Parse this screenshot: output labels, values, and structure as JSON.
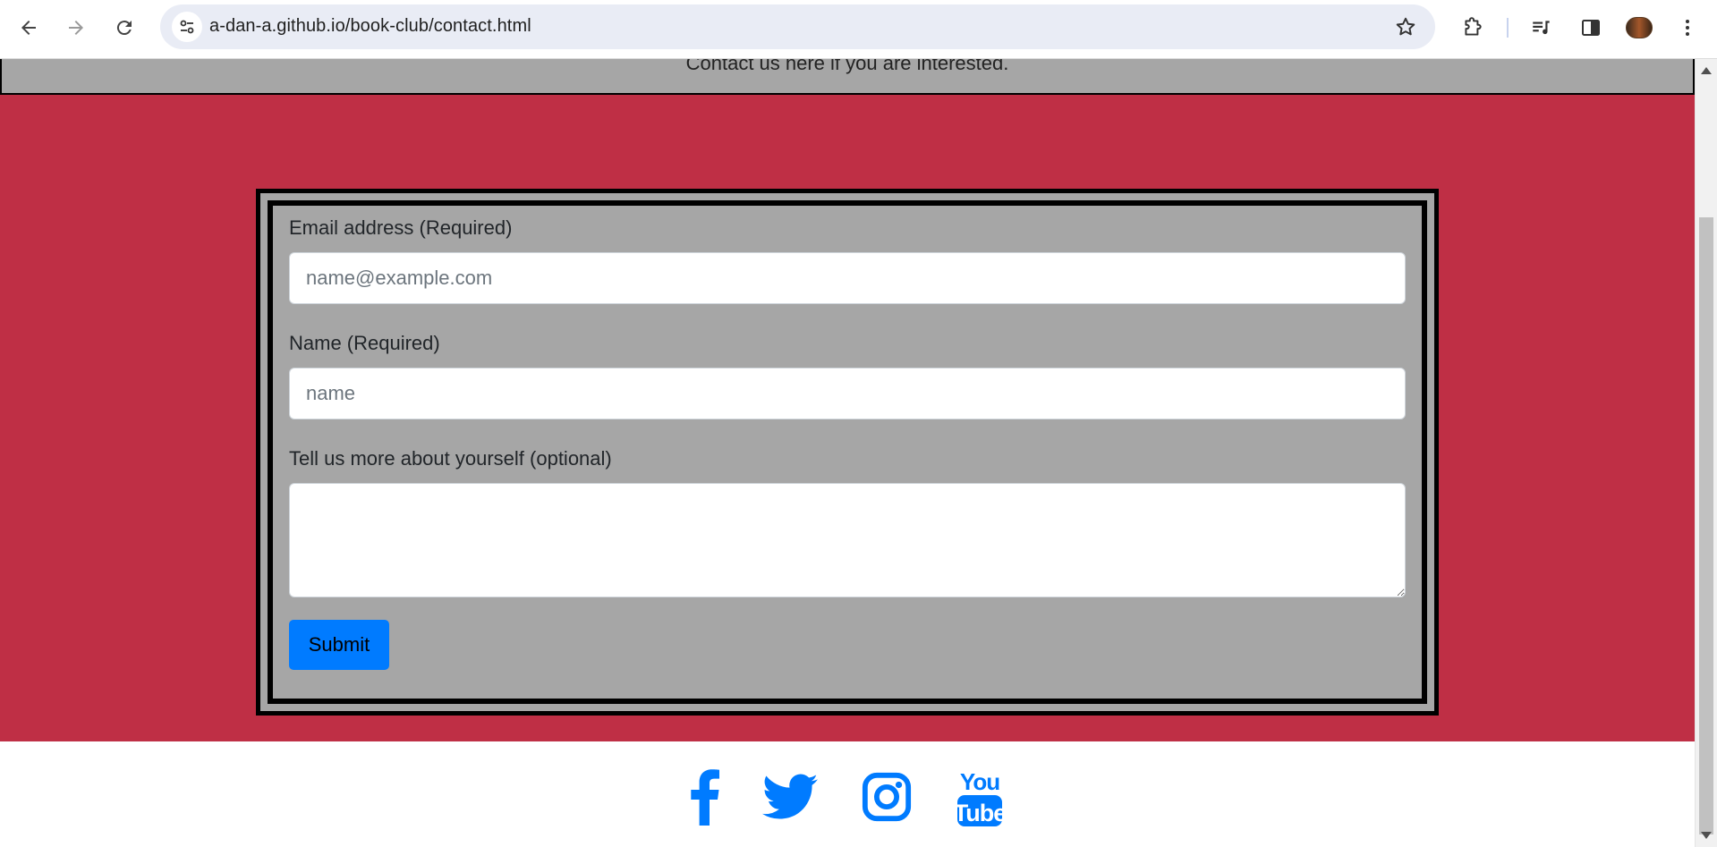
{
  "browser": {
    "url": "a-dan-a.github.io/book-club/contact.html",
    "icons": {
      "back": "arrow-left-icon",
      "forward": "arrow-right-icon",
      "reload": "reload-icon",
      "site_info": "tune-icon",
      "bookmark": "star-icon",
      "extensions": "puzzle-icon",
      "media": "playlist-icon",
      "side_panel": "side-panel-icon",
      "menu": "kebab-menu-icon"
    }
  },
  "page": {
    "intro_text": "Contact us here if you are interested.",
    "colors": {
      "background": "#bf2f45",
      "panel": "#a6a6a6",
      "accent": "#007bff"
    },
    "form": {
      "email_label": "Email address (Required)",
      "email_placeholder": "name@example.com",
      "name_label": "Name (Required)",
      "name_placeholder": "name",
      "about_label": "Tell us more about yourself (optional)",
      "about_value": "",
      "submit_label": "Submit"
    },
    "footer": {
      "social": [
        "facebook-icon",
        "twitter-icon",
        "instagram-icon",
        "youtube-icon"
      ]
    }
  }
}
